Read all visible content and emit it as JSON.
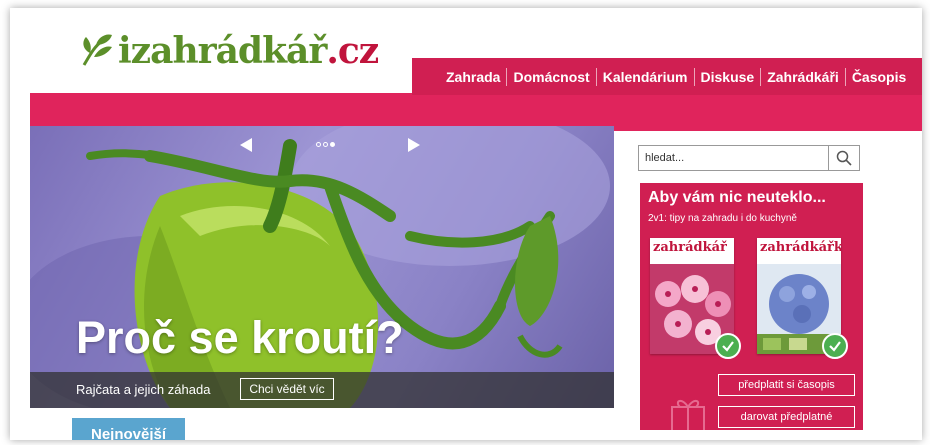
{
  "logo": {
    "text_green": "izahrádkář",
    "text_red": ".cz"
  },
  "nav": {
    "items": [
      "Zahrada",
      "Domácnost",
      "Kalendárium",
      "Diskuse",
      "Zahrádkáři",
      "Časopis"
    ]
  },
  "hero": {
    "title": "Proč se kroutí?",
    "subtitle": "Rajčata a jejich záhada",
    "button": "Chci vědět víc",
    "slides": 3,
    "active_slide": 3
  },
  "newest_tab": "Nejnovější",
  "search": {
    "placeholder": "hledat..."
  },
  "promo": {
    "title": "Aby vám nic neuteklo...",
    "subtitle": "2v1: tipy na zahradu i do kuchyně",
    "magazines": [
      "zahrádkář",
      "zahrádkářka"
    ],
    "buttons": [
      "předplatit si časopis",
      "darovat předplatné"
    ]
  },
  "colors": {
    "brand_pink": "#d01f52",
    "brand_green": "#5c8f2a",
    "tab_blue": "#5aa5cf"
  },
  "icons": [
    "leaf-logo-icon",
    "arrow-left-icon",
    "arrow-right-icon",
    "search-icon",
    "check-icon",
    "gift-icon"
  ]
}
